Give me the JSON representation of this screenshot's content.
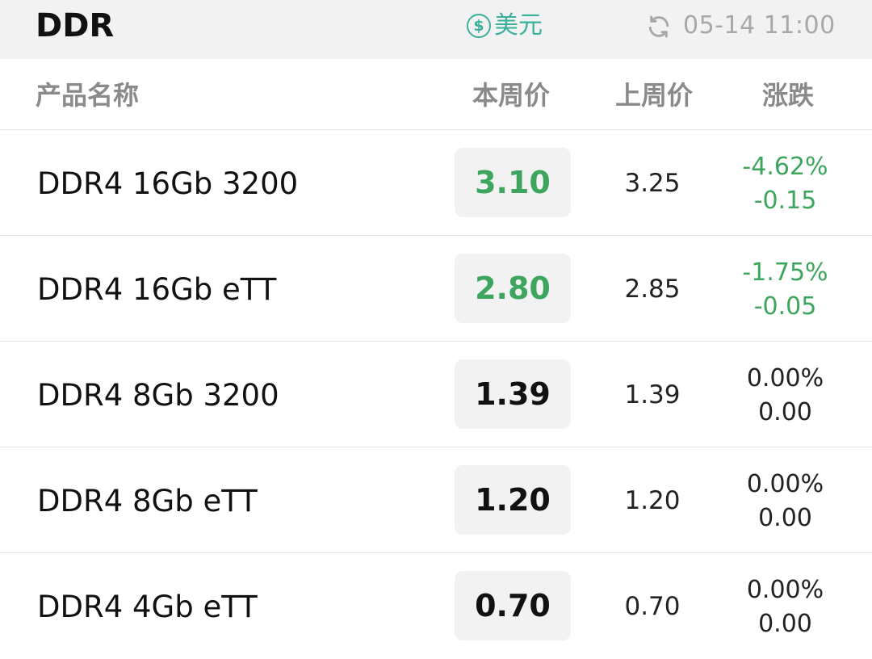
{
  "header": {
    "title": "DDR",
    "currency_symbol": "$",
    "currency_label": "美元",
    "timestamp": "05-14 11:00"
  },
  "columns": {
    "name": "产品名称",
    "this_week": "本周价",
    "last_week": "上周价",
    "change": "涨跌"
  },
  "colors": {
    "down_green": "#3da55d",
    "accent_teal": "#3bb09b",
    "muted_gray": "#a8a8a8"
  },
  "icons": {
    "currency": "dollar-circle-icon",
    "refresh": "refresh-icon"
  },
  "rows": [
    {
      "name": "DDR4 16Gb 3200",
      "this_week": "3.10",
      "last_week": "3.25",
      "change_pct": "-4.62%",
      "change_abs": "-0.15",
      "trend": "down"
    },
    {
      "name": "DDR4 16Gb eTT",
      "this_week": "2.80",
      "last_week": "2.85",
      "change_pct": "-1.75%",
      "change_abs": "-0.05",
      "trend": "down"
    },
    {
      "name": "DDR4 8Gb 3200",
      "this_week": "1.39",
      "last_week": "1.39",
      "change_pct": "0.00%",
      "change_abs": "0.00",
      "trend": "flat"
    },
    {
      "name": "DDR4 8Gb eTT",
      "this_week": "1.20",
      "last_week": "1.20",
      "change_pct": "0.00%",
      "change_abs": "0.00",
      "trend": "flat"
    },
    {
      "name": "DDR4 4Gb eTT",
      "this_week": "0.70",
      "last_week": "0.70",
      "change_pct": "0.00%",
      "change_abs": "0.00",
      "trend": "flat"
    }
  ]
}
